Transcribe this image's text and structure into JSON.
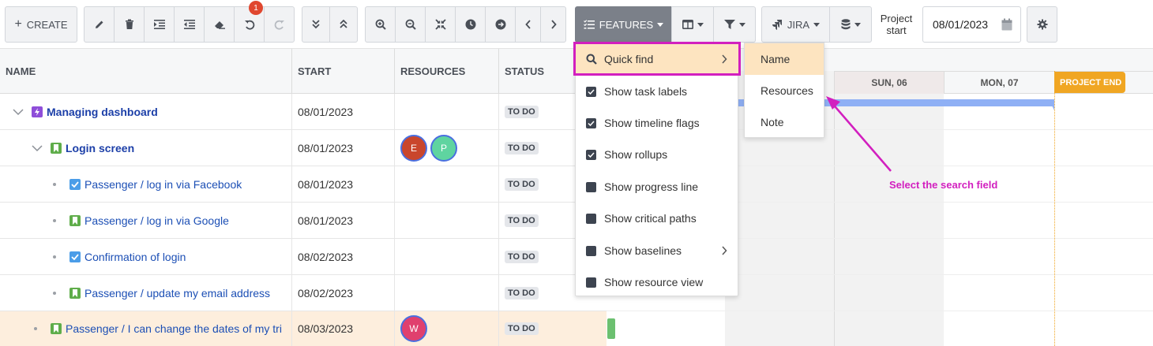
{
  "toolbar": {
    "create_label": "CREATE",
    "undo_badge": "1",
    "features_label": "FEATURES",
    "jira_label": "JIRA",
    "project_start_label": "Project start",
    "project_start_value": "08/01/2023"
  },
  "columns": {
    "name": "NAME",
    "start": "START",
    "resources": "RESOURCES",
    "status": "STATUS"
  },
  "gantt": {
    "day1": "SUN, 06",
    "day2": "MON, 07",
    "project_end": "PROJECT END"
  },
  "rows": [
    {
      "name": "Managing dashboard",
      "start": "08/01/2023",
      "status": "TO DO",
      "resources": []
    },
    {
      "name": "Login screen",
      "start": "08/01/2023",
      "status": "TO DO",
      "resources": [
        "E",
        "P"
      ]
    },
    {
      "name": "Passenger / log in via Facebook",
      "start": "08/01/2023",
      "status": "TO DO",
      "resources": []
    },
    {
      "name": "Passenger / log in via Google",
      "start": "08/01/2023",
      "status": "TO DO",
      "resources": []
    },
    {
      "name": "Confirmation of login",
      "start": "08/02/2023",
      "status": "TO DO",
      "resources": []
    },
    {
      "name": "Passenger / update my email address",
      "start": "08/02/2023",
      "status": "TO DO",
      "resources": []
    },
    {
      "name": "Passenger / I can change the dates of my tri",
      "start": "08/03/2023",
      "status": "TO DO",
      "resources": [
        "W"
      ]
    }
  ],
  "menu": {
    "items": [
      {
        "label": "Quick find"
      },
      {
        "label": "Show task labels"
      },
      {
        "label": "Show timeline flags"
      },
      {
        "label": "Show rollups"
      },
      {
        "label": "Show progress line"
      },
      {
        "label": "Show critical paths"
      },
      {
        "label": "Show baselines"
      },
      {
        "label": "Show resource view"
      }
    ]
  },
  "submenu": {
    "items": [
      {
        "label": "Name"
      },
      {
        "label": "Resources"
      },
      {
        "label": "Note"
      }
    ]
  },
  "annotation": {
    "text": "Select the search field"
  },
  "colors": {
    "highlight_border": "#d21fbf",
    "annotation": "#d21fbf",
    "project_end": "#f0a623",
    "link": "#1c4fb5"
  }
}
